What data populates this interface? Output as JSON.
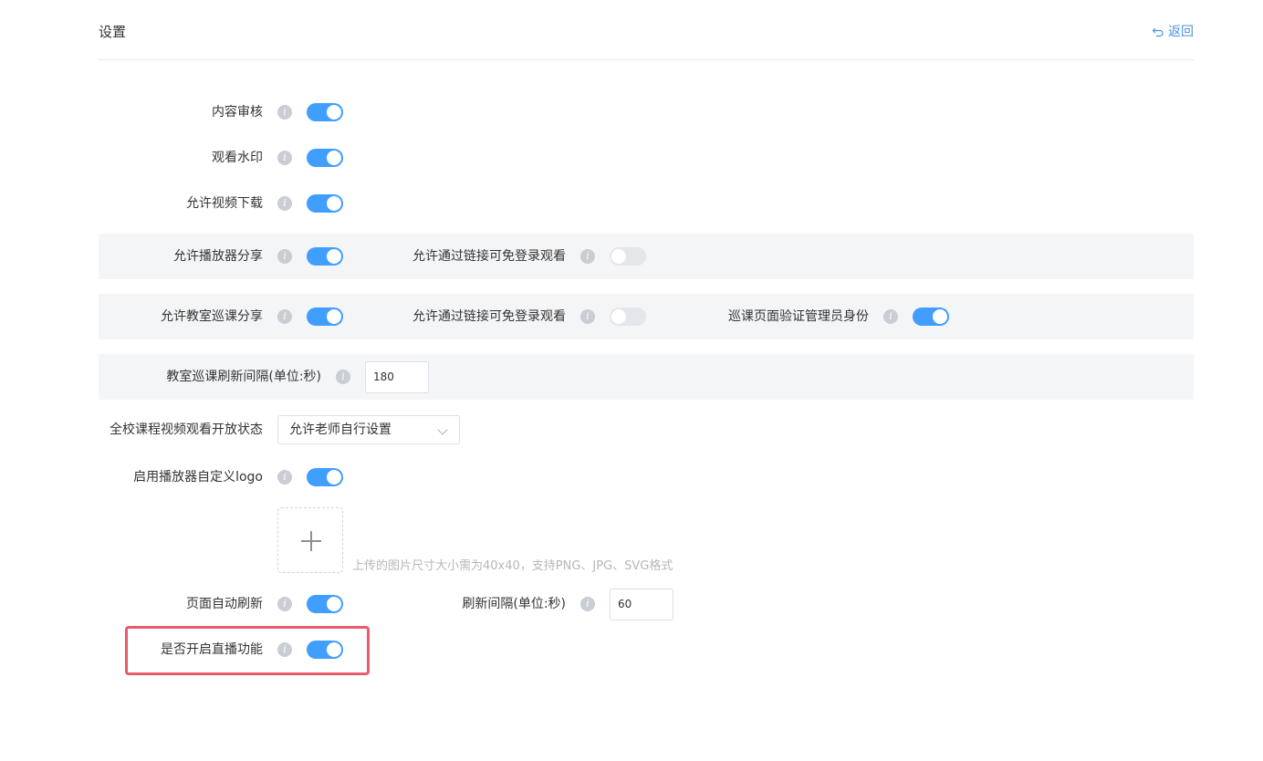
{
  "header": {
    "title": "设置",
    "back_label": "返回"
  },
  "settings": {
    "content_review": {
      "label": "内容审核",
      "enabled": true
    },
    "watermark": {
      "label": "观看水印",
      "enabled": true
    },
    "video_download": {
      "label": "允许视频下载",
      "enabled": true
    },
    "player_share": {
      "label": "允许播放器分享",
      "enabled": true
    },
    "player_share_link_login": {
      "label": "允许通过链接可免登录观看",
      "enabled": false
    },
    "classroom_share": {
      "label": "允许教室巡课分享",
      "enabled": true
    },
    "classroom_share_link_login": {
      "label": "允许通过链接可免登录观看",
      "enabled": false
    },
    "patrol_verify_admin": {
      "label": "巡课页面验证管理员身份",
      "enabled": true
    },
    "patrol_refresh_interval": {
      "label": "教室巡课刷新间隔(单位:秒)",
      "value": "180"
    },
    "video_open_status": {
      "label": "全校课程视频观看开放状态",
      "selected": "允许老师自行设置"
    },
    "custom_logo": {
      "label": "启用播放器自定义logo",
      "enabled": true,
      "upload_hint": "上传的图片尺寸大小需为40x40，支持PNG、JPG、SVG格式"
    },
    "auto_refresh": {
      "label": "页面自动刷新",
      "enabled": true
    },
    "refresh_interval": {
      "label": "刷新间隔(单位:秒)",
      "value": "60"
    },
    "live_streaming": {
      "label": "是否开启直播功能",
      "enabled": true
    }
  },
  "icons": {
    "info": "info-icon",
    "back": "undo-arrow-icon",
    "upload": "plus-icon",
    "dropdown": "chevron-down-icon"
  },
  "colors": {
    "switch_on": "#409eff",
    "switch_off": "#e4e6eb",
    "highlight": "#e85a6c",
    "link": "#4a90e2"
  }
}
